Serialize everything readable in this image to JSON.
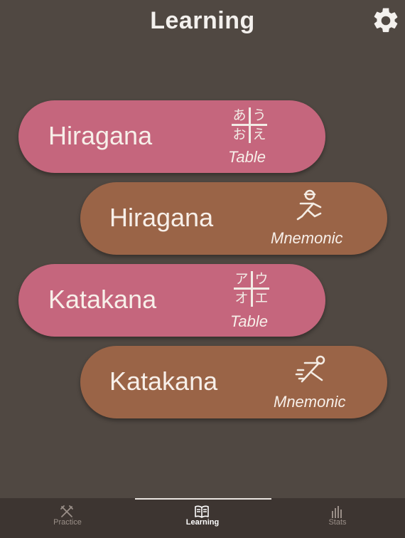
{
  "header": {
    "title": "Learning",
    "settings_icon": "gear-icon"
  },
  "cards": [
    {
      "label": "Hiragana",
      "sub": "Table",
      "kana": [
        "あ",
        "う",
        "お",
        "え"
      ],
      "color": "#c5667d",
      "icon": "kana-table-icon"
    },
    {
      "label": "Hiragana",
      "sub": "Mnemonic",
      "color": "#9a6447",
      "icon": "hiragana-mnemonic-icon"
    },
    {
      "label": "Katakana",
      "sub": "Table",
      "kana": [
        "ア",
        "ウ",
        "オ",
        "エ"
      ],
      "color": "#c5667d",
      "icon": "kana-table-icon"
    },
    {
      "label": "Katakana",
      "sub": "Mnemonic",
      "color": "#9a6447",
      "icon": "katakana-mnemonic-icon"
    }
  ],
  "bottom_nav": {
    "active": "Learning",
    "tabs": [
      {
        "label": "Practice",
        "icon": "practice-icon"
      },
      {
        "label": "Learning",
        "icon": "book-icon"
      },
      {
        "label": "Stats",
        "icon": "bar-chart-icon"
      }
    ]
  },
  "colors": {
    "background": "#504842",
    "pink": "#c5667d",
    "brown": "#9a6447",
    "nav_bar": "#3d3531"
  }
}
